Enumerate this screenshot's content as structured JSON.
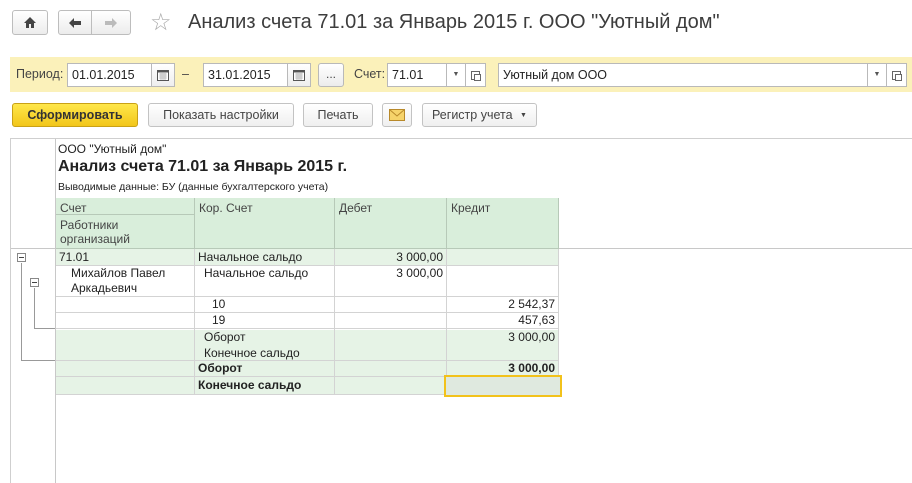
{
  "header": {
    "title": "Анализ счета 71.01 за Январь 2015 г. ООО \"Уютный дом\""
  },
  "filters": {
    "period_label": "Период:",
    "date_from": "01.01.2015",
    "dash": "–",
    "date_to": "31.01.2015",
    "dots": "...",
    "account_label": "Счет:",
    "account_value": "71.01",
    "org_value": "Уютный дом ООО"
  },
  "toolbar": {
    "generate_label": "Сформировать",
    "settings_label": "Показать настройки",
    "print_label": "Печать",
    "register_label": "Регистр учета"
  },
  "report": {
    "org": "ООО \"Уютный дом\"",
    "title": "Анализ счета 71.01 за Январь 2015 г.",
    "data_line": "Выводимые данные:  БУ (данные бухгалтерского учета)",
    "headers": {
      "account": "Счет",
      "subconto": "Работники организаций",
      "corr_account": "Кор. Счет",
      "debit": "Дебет",
      "credit": "Кредит"
    },
    "rows": [
      {
        "col1": "71.01",
        "col2": "Начальное сальдо",
        "debit": "3 000,00",
        "credit": ""
      },
      {
        "col1": "Михайлов Павел",
        "col1b": "Аркадьевич",
        "col2": "Начальное сальдо",
        "debit": "3 000,00",
        "credit": ""
      },
      {
        "col1": "",
        "col2": "10",
        "debit": "",
        "credit": "2 542,37"
      },
      {
        "col1": "",
        "col2": "19",
        "debit": "",
        "credit": "457,63"
      },
      {
        "col1": "",
        "col2": "Оборот",
        "debit": "",
        "credit": "3 000,00"
      },
      {
        "col1": "",
        "col2": "Конечное сальдо",
        "debit": "",
        "credit": ""
      },
      {
        "col1": "",
        "col2": "Оборот",
        "debit": "",
        "credit": "3 000,00"
      },
      {
        "col1": "",
        "col2": "Конечное сальдо",
        "debit": "",
        "credit": ""
      }
    ]
  }
}
